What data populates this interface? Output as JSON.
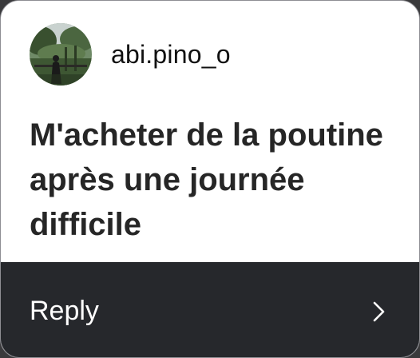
{
  "post": {
    "username": "abi.pino_o",
    "avatar_icon": "profile-photo-forest",
    "message": "M'acheter de la poutine après une journée difficile"
  },
  "reply": {
    "label": "Reply",
    "icon": "chevron-right-icon"
  },
  "colors": {
    "card_background": "#ffffff",
    "reply_bar_background": "#26282c",
    "text_dark": "#262626",
    "text_light": "#ffffff"
  }
}
